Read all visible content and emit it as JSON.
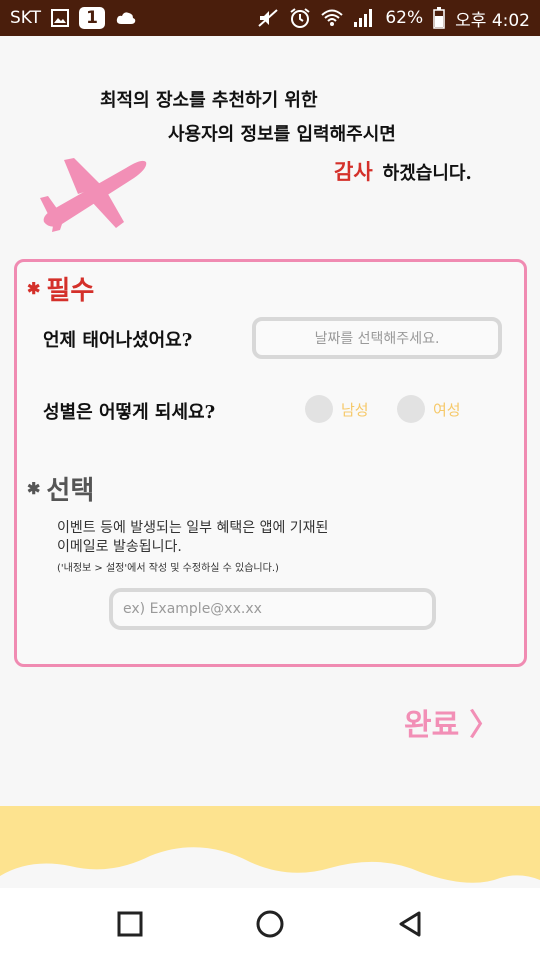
{
  "status_bar": {
    "carrier": "SKT",
    "badge": "1",
    "battery": "62%",
    "time": "오후 4:02"
  },
  "intro": {
    "line1": "최적의 장소를 추천하기 위한",
    "line2": "사용자의 정보를 입력해주시면",
    "line3_highlight": "감사",
    "line3_rest": "하겠습니다."
  },
  "required_section": {
    "star": "✱",
    "title": "필수",
    "birth_question": "언제 태어나셨어요?",
    "birth_placeholder": "날짜를 선택해주세요.",
    "gender_question": "성별은 어떻게 되세요?",
    "gender_options": [
      "남성",
      "여성"
    ]
  },
  "optional_section": {
    "star": "✱",
    "title": "선택",
    "info_line1": "이벤트 등에 발생되는 일부 혜택은 앱에 기재된",
    "info_line2": "이메일로 발송됩니다.",
    "info_small": "('내정보 > 설정'에서 작성 및 수정하실 수 있습니다.)",
    "email_placeholder": "ex) Example@xx.xx"
  },
  "done": {
    "label": "완료",
    "chevron": "〉"
  },
  "colors": {
    "status_bar": "#4a1e0c",
    "accent_pink": "#f08bb2",
    "required_red": "#d4302a",
    "radio_label": "#f6c96a",
    "wave_yellow": "#fde38f"
  }
}
